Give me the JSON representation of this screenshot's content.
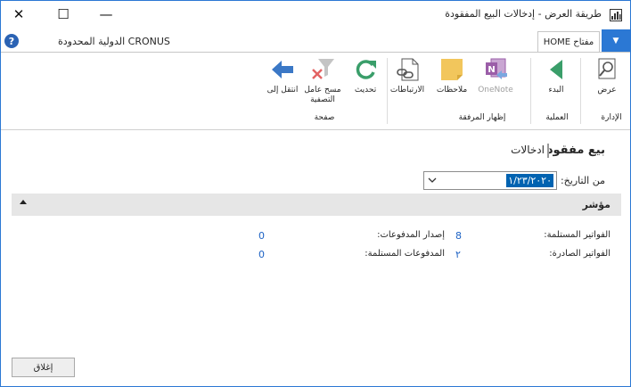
{
  "window": {
    "title": "طريقة العرض - إدخالات البيع المفقودة",
    "close_glyph": "✕",
    "maximize_glyph": "☐",
    "minimize_glyph": "—"
  },
  "nav": {
    "company": "CRONUS الدولية المحدودة",
    "home_tab": "مفتاح HOME",
    "help_glyph": "?",
    "menu_glyph": "▼"
  },
  "ribbon": {
    "buttons": {
      "view": "عرض",
      "start": "البدء",
      "onenote": "OneNote",
      "notes": "ملاحظات",
      "links": "الارتباطات",
      "refresh": "تحديث",
      "clear_filter": "مسح عامل التصفية",
      "goto": "انتقل إلى"
    },
    "groups": {
      "manage": "الإدارة",
      "process": "العملية",
      "show_attached": "إظهار المرفقة",
      "page": "صفحة"
    },
    "colors": {
      "green": "#3a9e6a",
      "blue": "#2b78d4",
      "purple": "#9b5ea8",
      "yellow": "#f2c65c",
      "red": "#e36363"
    }
  },
  "page": {
    "title": "بيع مفقود",
    "subtitle": "ادخالات",
    "from_label": "من التاريخ:",
    "from_value": "١/٢٣/٢٠٢٠",
    "cue": {
      "title": "مؤشر",
      "received_invoices_label": "الفواتير المستلمة:",
      "received_invoices_value": "8",
      "issued_invoices_label": "الفواتير الصادرة:",
      "issued_invoices_value": "٢",
      "payments_issued_label": "إصدار المدفوعات:",
      "payments_issued_value": "0",
      "payments_received_label": "المدفوعات المستلمة:",
      "payments_received_value": "0"
    },
    "close_label": "إغلاق"
  }
}
